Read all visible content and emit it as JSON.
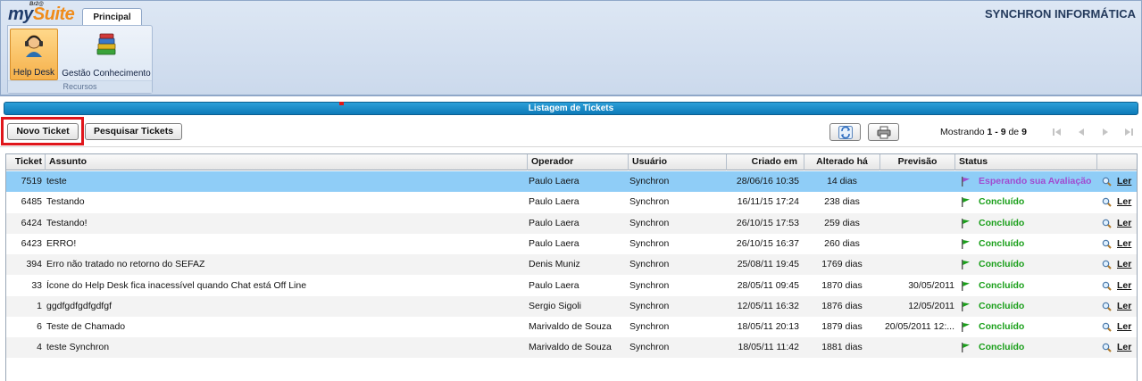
{
  "app": {
    "logo_prefix": "my",
    "logo_suffix": "Suite",
    "logo_small": "Br2@",
    "tab": "Principal",
    "company": "SYNCHRON INFORMÁTICA",
    "ribbon": {
      "help_desk": "Help Desk",
      "gestao": "Gestão Conhecimento",
      "group": "Recursos"
    }
  },
  "listing": {
    "title": "Listagem de Tickets",
    "novo_ticket": "Novo Ticket",
    "pesquisar_tickets": "Pesquisar Tickets",
    "mostrando_prefix": "Mostrando",
    "mostrando_range": "1 - 9",
    "mostrando_de": "de",
    "mostrando_total": "9"
  },
  "columns": [
    "Ticket",
    "Assunto",
    "Operador",
    "Usuário",
    "Criado em",
    "Alterado há",
    "Previsão",
    "Status"
  ],
  "rows": [
    {
      "ticket": "7519",
      "assunto": "teste",
      "operador": "Paulo Laera",
      "usuario": "Synchron",
      "criado": "28/06/16 10:35",
      "alterado": "14 dias",
      "previsao": "",
      "status": "Esperando sua Avaliação",
      "ler": "Ler"
    },
    {
      "ticket": "6485",
      "assunto": "Testando",
      "operador": "Paulo Laera",
      "usuario": "Synchron",
      "criado": "16/11/15 17:24",
      "alterado": "238 dias",
      "previsao": "",
      "status": "Concluído",
      "ler": "Ler"
    },
    {
      "ticket": "6424",
      "assunto": "Testando!",
      "operador": "Paulo Laera",
      "usuario": "Synchron",
      "criado": "26/10/15 17:53",
      "alterado": "259 dias",
      "previsao": "",
      "status": "Concluído",
      "ler": "Ler"
    },
    {
      "ticket": "6423",
      "assunto": "ERRO!",
      "operador": "Paulo Laera",
      "usuario": "Synchron",
      "criado": "26/10/15 16:37",
      "alterado": "260 dias",
      "previsao": "",
      "status": "Concluído",
      "ler": "Ler"
    },
    {
      "ticket": "394",
      "assunto": "Erro não tratado no retorno do SEFAZ",
      "operador": "Denis Muniz",
      "usuario": "Synchron",
      "criado": "25/08/11 19:45",
      "alterado": "1769 dias",
      "previsao": "",
      "status": "Concluído",
      "ler": "Ler"
    },
    {
      "ticket": "33",
      "assunto": "Ícone do Help Desk  fica inacessível quando Chat está Off Line",
      "operador": "Paulo Laera",
      "usuario": "Synchron",
      "criado": "28/05/11 09:45",
      "alterado": "1870 dias",
      "previsao": "30/05/2011",
      "status": "Concluído",
      "ler": "Ler"
    },
    {
      "ticket": "1",
      "assunto": "ggdfgdfgdfgdfgf",
      "operador": "Sergio Sigoli",
      "usuario": "Synchron",
      "criado": "12/05/11 16:32",
      "alterado": "1876 dias",
      "previsao": "12/05/2011",
      "status": "Concluído",
      "ler": "Ler"
    },
    {
      "ticket": "6",
      "assunto": "Teste de Chamado",
      "operador": "Marivaldo de Souza",
      "usuario": "Synchron",
      "criado": "18/05/11 20:13",
      "alterado": "1879 dias",
      "previsao": "20/05/2011 12:...",
      "status": "Concluído",
      "ler": "Ler"
    },
    {
      "ticket": "4",
      "assunto": "teste Synchron",
      "operador": "Marivaldo de Souza",
      "usuario": "Synchron",
      "criado": "18/05/11 11:42",
      "alterado": "1881 dias",
      "previsao": "",
      "status": "Concluído",
      "ler": "Ler"
    }
  ],
  "colors": {
    "title_bar": "#1489c8",
    "selected_row": "#8fcdf7",
    "status_done": "#1a9f1a",
    "status_waiting": "#a04bd0",
    "highlight": "#e0161b"
  }
}
